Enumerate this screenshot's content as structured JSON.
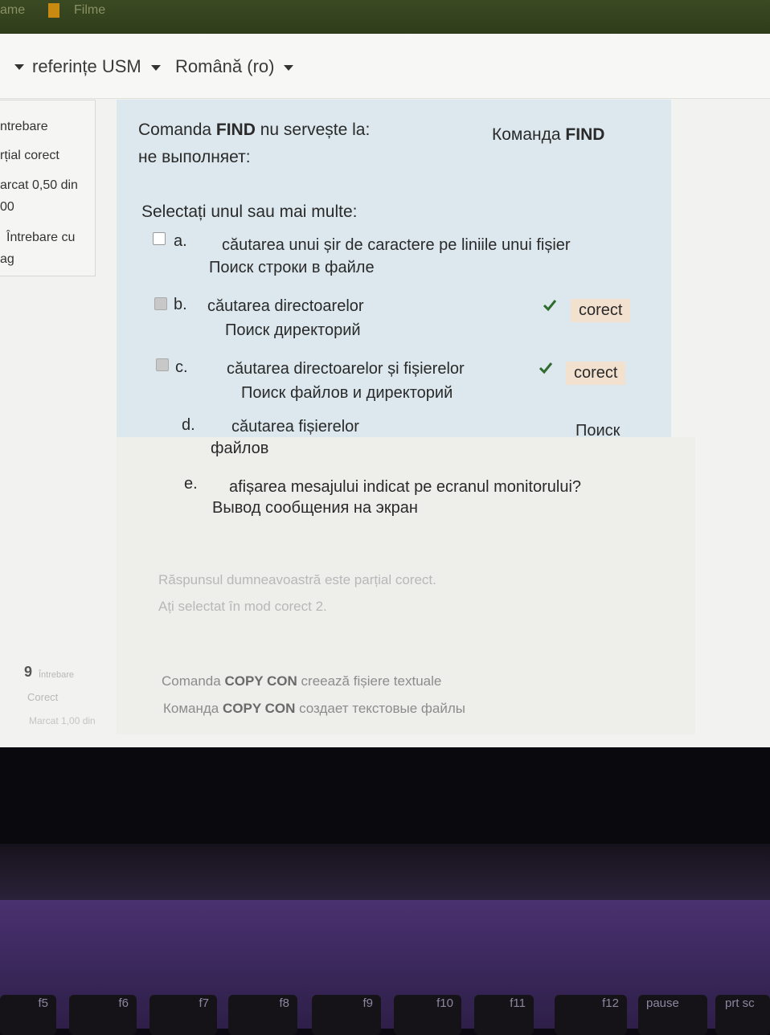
{
  "bookmarks": [
    "ame",
    "Filme"
  ],
  "navbar": {
    "links_label": "referințe USM",
    "language_label": "Română (ro)"
  },
  "info": {
    "lines": [
      "ntrebare",
      "rțial corect",
      "arcat 0,50 din",
      "00",
      "Întrebare cu",
      "ag"
    ]
  },
  "question": {
    "text_ro_prefix": "Comanda ",
    "keyword": "FIND",
    "text_ro_suffix": " nu servește la:",
    "text_ru_prefix": "Команда ",
    "text_ru_line2": "не выполняет:",
    "prompt": "Selectați unul sau mai multe:",
    "options": [
      {
        "letter": "a.",
        "ro": "căutarea unui șir de caractere pe liniile unui fișier",
        "ru": "Поиск строки в файле",
        "checked": false,
        "feedback": ""
      },
      {
        "letter": "b.",
        "ro": "căutarea directoarelor",
        "ru": "Поиск директорий",
        "checked": true,
        "feedback": "corect"
      },
      {
        "letter": "c.",
        "ro": "căutarea directoarelor și fișierelor",
        "ru": "Поиск файлов и директорий",
        "checked": true,
        "feedback": "corect"
      },
      {
        "letter": "d.",
        "ro": "căutarea fișierelor",
        "ru_a": "Поиск",
        "ru_b": "файлов",
        "checked": false,
        "feedback": ""
      },
      {
        "letter": "e.",
        "ro": "afișarea mesajului indicat pe ecranul monitorului?",
        "ru": "Вывод сообщения на экран",
        "checked": false,
        "feedback": ""
      }
    ],
    "result_line1": "Răspunsul dumneavoastră este parțial corect.",
    "result_line2": "Ați selectat în mod corect 2."
  },
  "next_question": {
    "number": "9",
    "label": "Întrebare",
    "status": "Corect",
    "mark": "Marcat 1,00 din",
    "text_ro_prefix": "Comanda ",
    "keyword": "COPY CON",
    "text_ro_suffix": " creează fișiere textuale",
    "text_ru_prefix": "Команда ",
    "text_ru_suffix": " создает текстовые файлы"
  },
  "keyboard": [
    "f5",
    "f6",
    "f7",
    "f8",
    "f9",
    "f10",
    "f11",
    "f12",
    "pause",
    "prt sc"
  ],
  "colors": {
    "check": "#2f6b2f",
    "badge": "#f3e1cf",
    "panel": "#dce8ee",
    "keyboard": "#3b2760"
  }
}
